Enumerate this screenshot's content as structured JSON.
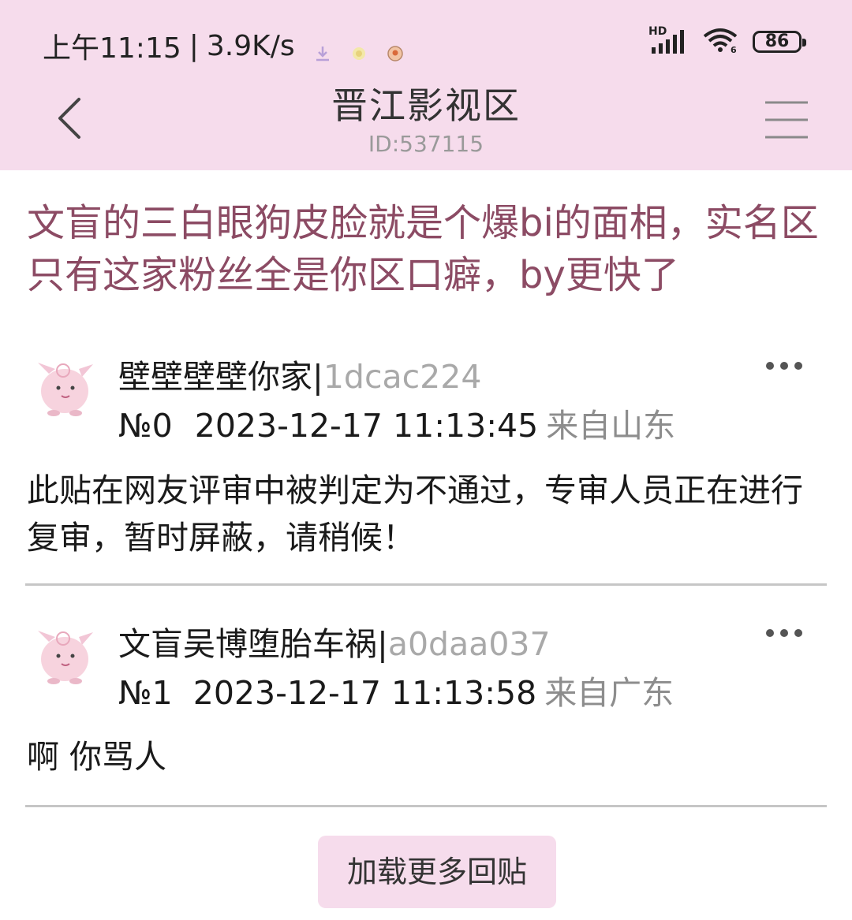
{
  "status_bar": {
    "time": "上午11:15",
    "separator": "|",
    "speed": "3.9K/s",
    "network": "HD",
    "battery": "86"
  },
  "header": {
    "title": "晋江影视区",
    "id_text": "ID:537115"
  },
  "thread": {
    "title": "文盲的三白眼狗皮脸就是个爆bi的面相，实名区只有这家粉丝全是你区口癖，by更快了"
  },
  "posts": [
    {
      "username": "壁壁壁壁你家",
      "sep": "|",
      "user_id": "1dcac224",
      "floor": "№0",
      "datetime": "2023-12-17 11:13:45",
      "location": "来自山东",
      "content": "此贴在网友评审中被判定为不通过，专审人员正在进行复审，暂时屏蔽，请稍候！"
    },
    {
      "username": "文盲吴博堕胎车祸",
      "sep": "|",
      "user_id": "a0daa037",
      "floor": "№1",
      "datetime": "2023-12-17 11:13:58",
      "location": "来自广东",
      "content": "啊 你骂人"
    }
  ],
  "load_more": "加载更多回贴",
  "colors": {
    "header_bg": "#f6dcec",
    "title_text": "#8c4b64",
    "muted": "#a9a9a9"
  }
}
